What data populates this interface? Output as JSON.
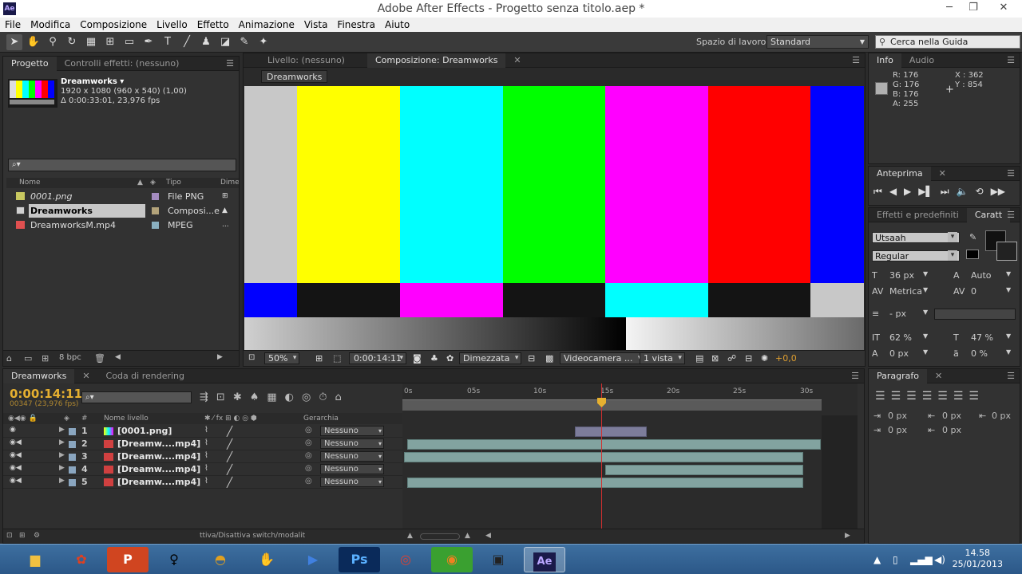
{
  "window": {
    "title": "Adobe After Effects - Progetto senza titolo.aep *",
    "app_icon": "Ae",
    "buttons": [
      "minimize-icon",
      "maximize-icon",
      "close-icon"
    ]
  },
  "menu": [
    "File",
    "Modifica",
    "Composizione",
    "Livello",
    "Effetto",
    "Animazione",
    "Vista",
    "Finestra",
    "Aiuto"
  ],
  "toolbar": {
    "workspace_label": "Spazio di lavoro:",
    "workspace_value": "Standard",
    "help_placeholder": "Cerca nella Guida"
  },
  "project": {
    "tabs": [
      "Progetto",
      "Controlli effetti: (nessuno)"
    ],
    "selected_name": "Dreamworks ▾",
    "selected_info1": "1920 x 1080  (960 x 540) (1,00)",
    "selected_info2": "Δ 0:00:33:01, 23,976 fps",
    "search_placeholder": "⌕▾",
    "columns": [
      "Nome",
      "Tipo",
      "Dimen"
    ],
    "items": [
      {
        "name": "0001.png",
        "type": "File PNG",
        "extra": "",
        "label_color": "#a48cc0",
        "icon_color": "#c8c860"
      },
      {
        "name": "Dreamworks",
        "type": "Composi...e",
        "extra": "",
        "label_color": "#b3a37a",
        "icon_color": "#d0d0d0"
      },
      {
        "name": "DreamworksM.mp4",
        "type": "MPEG",
        "extra": "...",
        "label_color": "#8ab0c0",
        "icon_color": "#e05050"
      }
    ],
    "bpc": "8 bpc"
  },
  "composition": {
    "tabs": [
      "Livello: (nessuno)",
      "Composizione: Dreamworks"
    ],
    "subtab": "Dreamworks",
    "zoom": "50%",
    "timecode": "0:00:14:11",
    "resolution": "Dimezzata",
    "camera": "Videocamera ...",
    "views": "1 vista",
    "exposure": "+0,0"
  },
  "info": {
    "tabs": [
      "Info",
      "Audio"
    ],
    "r": "R:  176",
    "g": "G:  176",
    "b": "B:  176",
    "a": "A:  255",
    "x": "X : 362",
    "y": "Y : 854",
    "swatch_color": "#b0b0b0"
  },
  "preview": {
    "tabs": [
      "Anteprima"
    ]
  },
  "character": {
    "tabs": [
      "Effetti e predefiniti",
      "Caratt"
    ],
    "font": "Utsaah",
    "style": "Regular",
    "size": "36 px",
    "leading": "Auto",
    "kerning": "Metrica",
    "tracking": "0",
    "stroke": "- px",
    "vscale": "62 %",
    "hscale": "47 %",
    "baseline": "0 px",
    "tsume": "0 %"
  },
  "timeline": {
    "tabs": [
      "Dreamworks",
      "Coda di rendering"
    ],
    "timecode": "0:00:14:11",
    "frames": "00347 (23,976 fps)",
    "columns": [
      "#",
      "Nome livello",
      "Gerarchia"
    ],
    "ruler": [
      "0s",
      "05s",
      "10s",
      "15s",
      "20s",
      "25s",
      "30s"
    ],
    "layers": [
      {
        "num": "1",
        "name": "[0001.png]",
        "parent": "Nessuno"
      },
      {
        "num": "2",
        "name": "[Dreamw....mp4]",
        "parent": "Nessuno"
      },
      {
        "num": "3",
        "name": "[Dreamw....mp4]",
        "parent": "Nessuno"
      },
      {
        "num": "4",
        "name": "[Dreamw....mp4]",
        "parent": "Nessuno"
      },
      {
        "num": "5",
        "name": "[Dreamw....mp4]",
        "parent": "Nessuno"
      }
    ],
    "footer": "ttiva/Disattiva switch/modalit"
  },
  "paragraph": {
    "tabs": [
      "Paragrafo"
    ],
    "indent_left": "0 px",
    "indent_first": "0 px",
    "indent_right": "0 px",
    "space_before": "0 px",
    "space_after": "0 px"
  },
  "taskbar": {
    "apps": [
      "explorer",
      "paint",
      "powerpoint",
      "figure",
      "headphones",
      "hand",
      "media-player",
      "photoshop",
      "chrome",
      "blender",
      "film",
      "after-effects"
    ],
    "time": "14.58",
    "date": "25/01/2013"
  }
}
